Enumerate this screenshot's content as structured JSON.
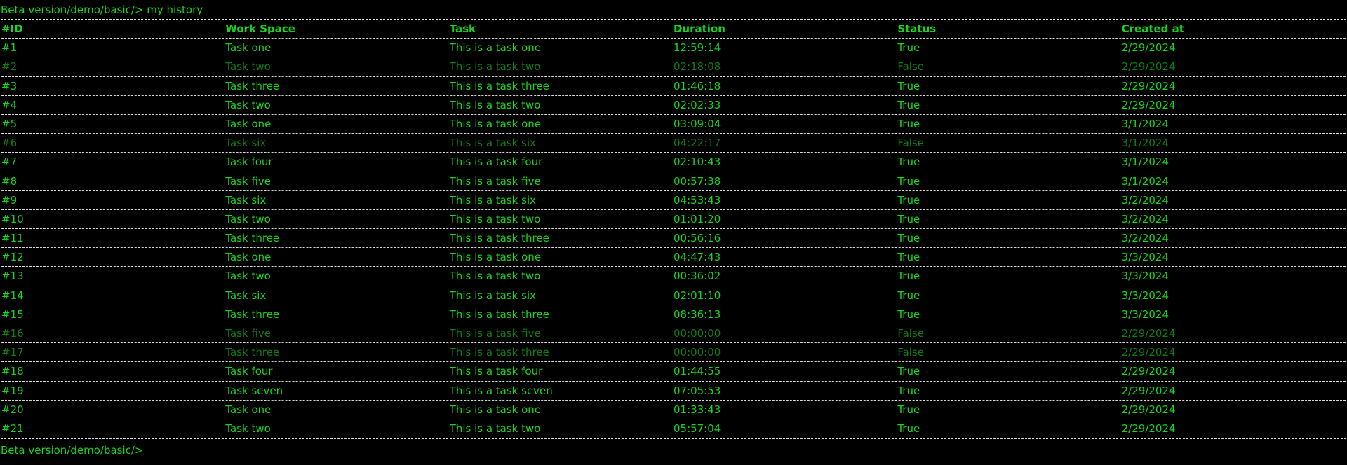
{
  "prompt": {
    "path": "Beta version/demo/basic/>",
    "command": "my history"
  },
  "columns": [
    "#ID",
    "Work Space",
    "Task",
    "Duration",
    "Status",
    "Created at"
  ],
  "rows": [
    [
      "#1",
      "Task one",
      "This is a task one",
      "12:59:14",
      "True",
      "2/29/2024"
    ],
    [
      "#2",
      "Task two",
      "This is a task two",
      "02:18:08",
      "False",
      "2/29/2024"
    ],
    [
      "#3",
      "Task three",
      "This is a task three",
      "01:46:18",
      "True",
      "2/29/2024"
    ],
    [
      "#4",
      "Task two",
      "This is a task two",
      "02:02:33",
      "True",
      "2/29/2024"
    ],
    [
      "#5",
      "Task one",
      "This is a task one",
      "03:09:04",
      "True",
      "3/1/2024"
    ],
    [
      "#6",
      "Task six",
      "This is a task six",
      "04:22:17",
      "False",
      "3/1/2024"
    ],
    [
      "#7",
      "Task four",
      "This is a task four",
      "02:10:43",
      "True",
      "3/1/2024"
    ],
    [
      "#8",
      "Task five",
      "This is a task five",
      "00:57:38",
      "True",
      "3/1/2024"
    ],
    [
      "#9",
      "Task six",
      "This is a task six",
      "04:53:43",
      "True",
      "3/2/2024"
    ],
    [
      "#10",
      "Task two",
      "This is a task two",
      "01:01:20",
      "True",
      "3/2/2024"
    ],
    [
      "#11",
      "Task three",
      "This is a task three",
      "00:56:16",
      "True",
      "3/2/2024"
    ],
    [
      "#12",
      "Task one",
      "This is a task one",
      "04:47:43",
      "True",
      "3/3/2024"
    ],
    [
      "#13",
      "Task two",
      "This is a task two",
      "00:36:02",
      "True",
      "3/3/2024"
    ],
    [
      "#14",
      "Task six",
      "This is a task six",
      "02:01:10",
      "True",
      "3/3/2024"
    ],
    [
      "#15",
      "Task three",
      "This is a task three",
      "08:36:13",
      "True",
      "3/3/2024"
    ],
    [
      "#16",
      "Task five",
      "This is a task five",
      "00:00:00",
      "False",
      "2/29/2024"
    ],
    [
      "#17",
      "Task three",
      "This is a task three",
      "00:00:00",
      "False",
      "2/29/2024"
    ],
    [
      "#18",
      "Task four",
      "This is a task four",
      "01:44:55",
      "True",
      "2/29/2024"
    ],
    [
      "#19",
      "Task seven",
      "This is a task seven",
      "07:05:53",
      "True",
      "2/29/2024"
    ],
    [
      "#20",
      "Task one",
      "This is a task one",
      "01:33:43",
      "True",
      "2/29/2024"
    ],
    [
      "#21",
      "Task two",
      "This is a task two",
      "05:57:04",
      "True",
      "2/29/2024"
    ]
  ],
  "colors": {
    "background": "#000000",
    "text_active": "#19d41c",
    "text_inactive": "#0f7d12",
    "border": "#d8d8d8"
  }
}
